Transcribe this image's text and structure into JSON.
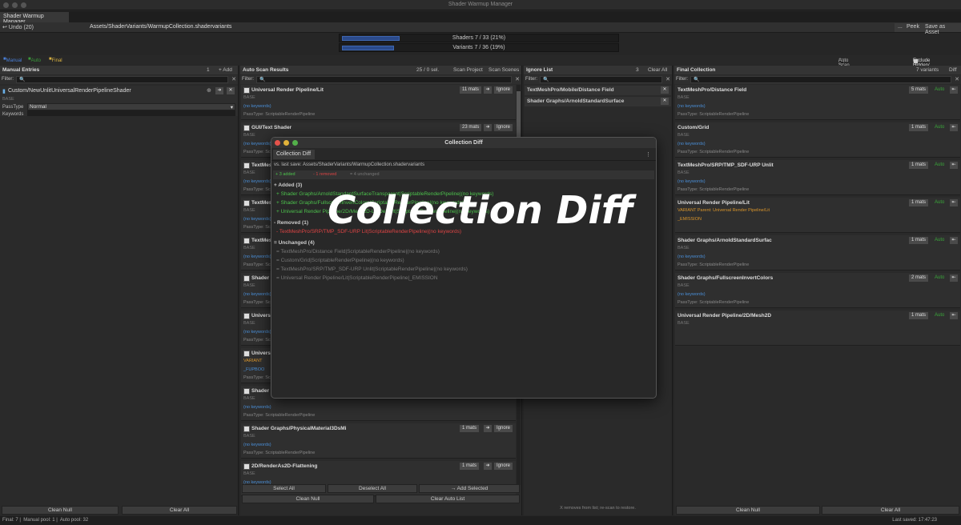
{
  "window": {
    "title": "Shader Warmup Manager"
  },
  "tab": "Shader Warmup Manager",
  "toolbar": {
    "undo": "↩ Undo (20)",
    "path": "Assets/ShaderVariants/WarmupCollection.shadervariants",
    "more": "...",
    "peek": "Peek",
    "save_as": "Save as Asset"
  },
  "progress": {
    "shaders": "Shaders  7 / 33  (21%)",
    "shaders_pct": 21,
    "variants": "Variants  7 / 36  (19%)",
    "variants_pct": 19
  },
  "legend": {
    "manual": "Manual",
    "auto": "Auto",
    "final": "Final",
    "auto_scan": "Auto Scan & Save on Build",
    "exclude": "Exclude Hidden/"
  },
  "manual": {
    "title": "Manual Entries",
    "count": "1",
    "add": "+ Add",
    "filter": "Filter:",
    "shader": "Custom/NewUnlitUniversalRenderPipelineShader",
    "base": "BASE",
    "passtype_label": "PassType",
    "passtype_value": "Normal",
    "keywords_label": "Keywords",
    "clean_null": "Clean Null",
    "clear_all": "Clear All"
  },
  "autoscan": {
    "title": "Auto Scan Results",
    "count": "25 / 0 sel.",
    "scan_project": "Scan Project",
    "scan_scenes": "Scan Scenes",
    "filter": "Filter:",
    "cards": [
      {
        "name": "Universal Render Pipeline/Lit",
        "mats": "11 mats",
        "base": "BASE",
        "kw": "(no keywords)",
        "pass": "PassType: ScriptableRenderPipeline"
      },
      {
        "name": "GUI/Text Shader",
        "mats": "23 mats",
        "base": "BASE",
        "kw": "(no keywords)",
        "pass": "PassType: ScriptableRenderPipeline"
      },
      {
        "name": "TextMeshPro/Distance Field",
        "mats": "",
        "base": "BASE",
        "kw": "(no keywords)",
        "pass": "PassType: ScriptableRenderPipeline"
      },
      {
        "name": "TextMeshPro/Mobile",
        "mats": "",
        "base": "BASE",
        "kw": "(no keywords)",
        "pass": "PassType: ScriptableRenderPipeline"
      },
      {
        "name": "TextMeshPro/SRP",
        "mats": "",
        "base": "BASE",
        "kw": "(no keywords)",
        "pass": "PassType: ScriptableRenderPipeline"
      },
      {
        "name": "Shader Graphs",
        "mats": "",
        "base": "BASE",
        "kw": "(no keywords)",
        "pass": "PassType: ScriptableRenderPipeline"
      },
      {
        "name": "Universal Render Pipeline/Simple",
        "mats": "",
        "base": "BASE",
        "kw": "(no keywords)",
        "pass": "PassType: ScriptableRenderPipeline"
      },
      {
        "name": "Universal Render Pipeline/Lit",
        "mats": "",
        "base": "VARIANT",
        "kw": "_FUPBOO",
        "pass": "PassType: ScriptableRenderPipeline"
      },
      {
        "name": "Shader Graphs/Glass",
        "mats": "",
        "base": "BASE",
        "kw": "(no keywords)",
        "pass": "PassType: ScriptableRenderPipeline"
      },
      {
        "name": "Shader Graphs/PhysicalMaterial3DsMi",
        "mats": "1 mats",
        "base": "BASE",
        "kw": "(no keywords)",
        "pass": "PassType: ScriptableRenderPipeline"
      },
      {
        "name": "2D/RenderAs2D-Flattening",
        "mats": "1 mats",
        "base": "BASE",
        "kw": "(no keywords)",
        "pass": ""
      }
    ],
    "ignore": "Ignore",
    "select_all": "Select All",
    "deselect_all": "Deselect All",
    "add_selected": "→ Add Selected",
    "clean_null": "Clean Null",
    "clear_auto": "Clear Auto List"
  },
  "ignores": {
    "title": "Ignore List",
    "count": "3",
    "clear_all": "Clear All",
    "filter": "Filter:",
    "items": [
      "TextMeshPro/Mobile/Distance Field",
      "Shader Graphs/ArnoldStandardSurface"
    ],
    "note": "X removes from list; re-scan to restore."
  },
  "final": {
    "title": "Final Collection",
    "count": "7 variants",
    "diff": "Diff",
    "filter": "Filter:",
    "cards": [
      {
        "name": "TextMeshPro/Distance Field",
        "mats": "5 mats",
        "base": "BASE",
        "kw": "(no keywords)",
        "pass": "PassType: ScriptableRenderPipeline"
      },
      {
        "name": "Custom/Grid",
        "mats": "1 mats",
        "base": "BASE",
        "kw": "(no keywords)",
        "pass": "PassType: ScriptableRenderPipeline"
      },
      {
        "name": "TextMeshPro/SRP/TMP_SDF-URP Unlit",
        "mats": "1 mats",
        "base": "BASE",
        "kw": "(no keywords)",
        "pass": "PassType: ScriptableRenderPipeline"
      },
      {
        "name": "Universal Render Pipeline/Lit",
        "mats": "1 mats",
        "base": "VARIANT  Parent: Universal Render Pipeline/Lit",
        "kw": "_EMISSION",
        "pass": ""
      },
      {
        "name": "Shader Graphs/ArnoldStandardSurfac",
        "mats": "1 mats",
        "base": "BASE",
        "kw": "(no keywords)",
        "pass": "PassType: ScriptableRenderPipeline"
      },
      {
        "name": "Shader Graphs/FullscreenInvertColors",
        "mats": "2 mats",
        "base": "BASE",
        "kw": "(no keywords)",
        "pass": "PassType: ScriptableRenderPipeline"
      },
      {
        "name": "Universal Render Pipeline/2D/Mesh2D",
        "mats": "1 mats",
        "base": "BASE",
        "kw": "",
        "pass": ""
      }
    ],
    "auto": "Auto",
    "clean_null": "Clean Null",
    "clear_all": "Clear All"
  },
  "status": {
    "final": "Final: 7",
    "manual": "Manual pool: 1",
    "auto": "Auto pool: 32",
    "saved": "Last saved: 17:47:23"
  },
  "dialog": {
    "title": "Collection Diff",
    "tab": "Collection Diff",
    "vs": "vs. last save: Assets/ShaderVariants/WarmupCollection.shadervariants",
    "summary_added": "+ 3 added",
    "summary_removed": "- 1 removed",
    "summary_unchanged": "= 4 unchanged",
    "added_header": "+ Added (3)",
    "added": [
      "+ Shader Graphs/ArnoldStandardSurfaceTransparent|ScriptableRenderPipeline|(no keywords)",
      "+ Shader Graphs/FullscreenInvertColors|ScriptableRenderPipeline|(no keywords)",
      "+ Universal Render Pipeline/2D/Mesh2D-Lit-Default|ScriptableRenderPipeline|(no keywords)"
    ],
    "removed_header": "- Removed (1)",
    "removed": [
      "- TextMeshPro/SRP/TMP_SDF-URP Lit|ScriptableRenderPipeline|(no keywords)"
    ],
    "unchanged_header": "= Unchanged (4)",
    "unchanged": [
      "= TextMeshPro/Distance Field|ScriptableRenderPipeline|(no keywords)",
      "= Custom/Grid|ScriptableRenderPipeline|(no keywords)",
      "= TextMeshPro/SRP/TMP_SDF-URP Unlit|ScriptableRenderPipeline|(no keywords)",
      "= Universal Render Pipeline/Lit|ScriptableRenderPipeline|_EMISSION"
    ],
    "overlay": "Collection Diff"
  }
}
